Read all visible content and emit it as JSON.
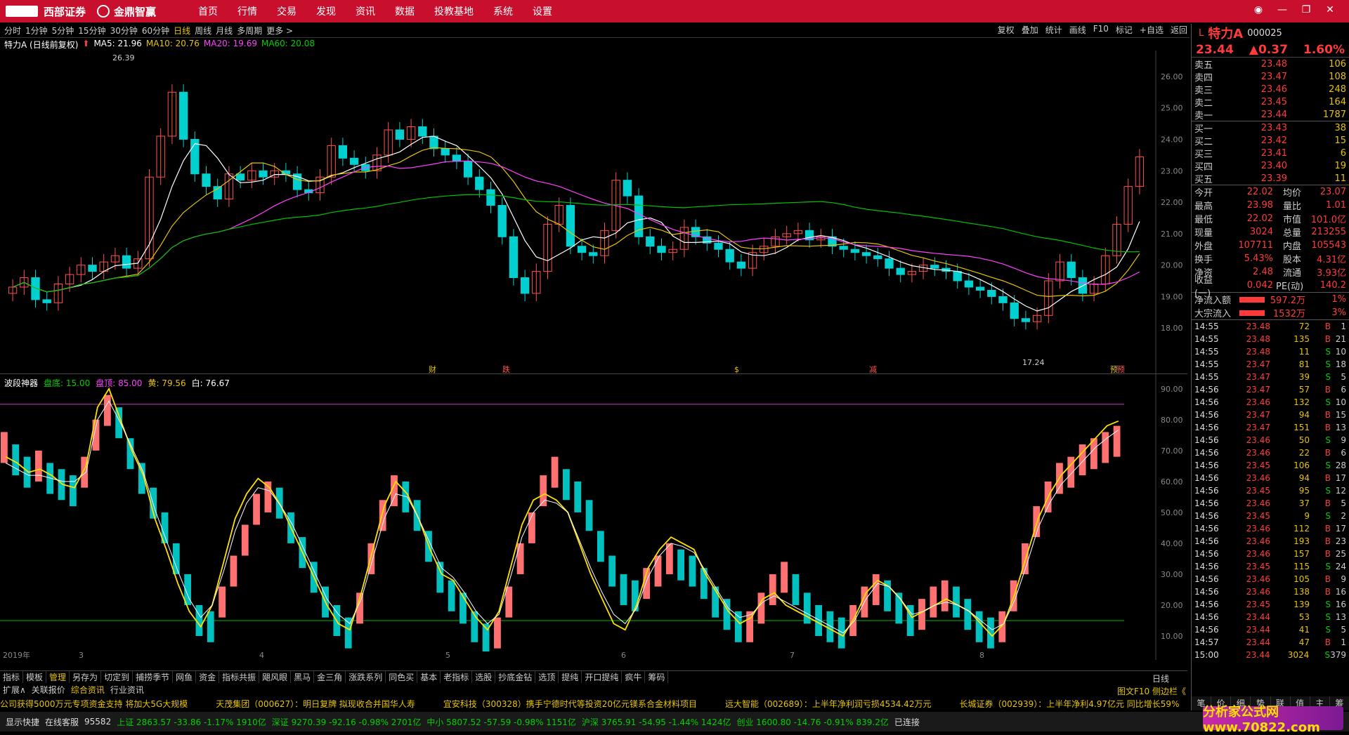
{
  "app": {
    "broker": "西部证券",
    "product": "金鼎智赢"
  },
  "menu": [
    "首页",
    "行情",
    "交易",
    "发现",
    "资讯",
    "数据",
    "投教基地",
    "系统",
    "设置"
  ],
  "periods": [
    "分时",
    "1分钟",
    "5分钟",
    "15分钟",
    "30分钟",
    "60分钟",
    "日线",
    "周线",
    "月线",
    "多周期",
    "更多 >"
  ],
  "active_period": "日线",
  "right_tools": [
    "复权",
    "叠加",
    "统计",
    "画线",
    "F10",
    "标记",
    "+自选",
    "返回"
  ],
  "stock": {
    "name": "特力A",
    "code": "000025",
    "price": "23.44",
    "change": "▲0.37",
    "pct": "1.60%",
    "subtitle": "特力A (日线前复权)"
  },
  "ma": {
    "ma5": "MA5: 21.96",
    "ma10": "MA10: 20.76",
    "ma20": "MA20: 19.69",
    "ma60": "MA60: 20.08"
  },
  "price_axis": [
    "26.00",
    "25.00",
    "24.00",
    "23.00",
    "22.00",
    "21.00",
    "20.00",
    "19.00",
    "18.00"
  ],
  "price_hi": "26.39",
  "price_lo": "17.24",
  "events": [
    "财",
    "跌",
    "$",
    "减",
    "预",
    "预"
  ],
  "indicator": {
    "name": "波段神器",
    "bottom": "盘底: 15.00",
    "top": "盘顶: 85.00",
    "yellow": "黄: 79.56",
    "white": "白: 76.67"
  },
  "ind_axis": [
    "90.00",
    "80.00",
    "70.00",
    "60.00",
    "50.00",
    "40.00",
    "30.00",
    "20.00",
    "10.00"
  ],
  "x_axis": [
    "2019年",
    "3",
    "4",
    "5",
    "6",
    "7",
    "8"
  ],
  "bottom_tabs": [
    "指标",
    "模板",
    "管理",
    "另存为",
    "切定到",
    "捕捞季节",
    "网鱼",
    "资金",
    "指标共振",
    "飓风眼",
    "黑马",
    "金三角",
    "涨跌系列",
    "同色买",
    "基本",
    "老指标",
    "选股",
    "抄底金钻",
    "选顶",
    "提纯",
    "开口提纯",
    "疯牛",
    "筹码"
  ],
  "sub_tabs": [
    "扩展∧",
    "关联报价",
    "综合资讯",
    "行业资讯"
  ],
  "right_label": "日线",
  "f10_label": "图文F10 侧边栏《",
  "ticker": [
    "公司获得5000万元专项资金支持 将加大5G大规模",
    "天茂集团（000627）：明日复牌 拟现收合并国华人寿",
    "宜安科技（300328）携手宁德时代等投资20亿元镁系合金材料项目",
    "远大智能（002689）：上半年净利润亏损4534.42万元",
    "长城证券（002939）：上半年净利4.97亿元 同比增长59%"
  ],
  "status": {
    "show": "显示快捷",
    "service": "在线客服",
    "phone": "95582",
    "sh": "上证 2863.57 -33.86 -1.17% 1910亿",
    "sz": "深证 9270.39 -92.16 -0.98% 2701亿",
    "zx": "中小 5807.52 -57.59 -0.98% 1151亿",
    "hs": "沪深 3765.91 -54.95 -1.44% 1424亿",
    "cy": "创业 1600.80 -14.76 -0.91% 839.2亿",
    "conn": "已连接"
  },
  "asks": [
    [
      "卖五",
      "23.48",
      "106"
    ],
    [
      "卖四",
      "23.47",
      "108"
    ],
    [
      "卖三",
      "23.46",
      "248"
    ],
    [
      "卖二",
      "23.45",
      "164"
    ],
    [
      "卖一",
      "23.44",
      "1787"
    ]
  ],
  "bids": [
    [
      "买一",
      "23.43",
      "38"
    ],
    [
      "买二",
      "23.42",
      "15"
    ],
    [
      "买三",
      "23.41",
      "6"
    ],
    [
      "买四",
      "23.40",
      "19"
    ],
    [
      "买五",
      "23.39",
      "11"
    ]
  ],
  "stats": [
    [
      "今开",
      "22.02",
      "均价",
      "23.07"
    ],
    [
      "最高",
      "23.98",
      "量比",
      "1.01"
    ],
    [
      "最低",
      "22.02",
      "市值",
      "101.0亿"
    ],
    [
      "现量",
      "3024",
      "总量",
      "213255"
    ],
    [
      "外盘",
      "107711",
      "内盘",
      "105543"
    ],
    [
      "换手",
      "5.43%",
      "股本",
      "4.31亿"
    ],
    [
      "净资",
      "2.48",
      "流通",
      "3.93亿"
    ],
    [
      "收益(一)",
      "0.042",
      "PE(动)",
      "140.2"
    ]
  ],
  "flows": [
    [
      "净流入额",
      "597.2万",
      "1%"
    ],
    [
      "大宗流入",
      "1532万",
      "3%"
    ]
  ],
  "trades": [
    [
      "14:55",
      "23.48",
      "72",
      "B",
      "1"
    ],
    [
      "14:55",
      "23.48",
      "135",
      "B",
      "21"
    ],
    [
      "14:55",
      "23.48",
      "11",
      "S",
      "10"
    ],
    [
      "14:55",
      "23.47",
      "81",
      "S",
      "18"
    ],
    [
      "14:55",
      "23.47",
      "39",
      "S",
      "5"
    ],
    [
      "14:56",
      "23.47",
      "57",
      "B",
      "6"
    ],
    [
      "14:56",
      "23.46",
      "132",
      "S",
      "10"
    ],
    [
      "14:56",
      "23.47",
      "94",
      "B",
      "15"
    ],
    [
      "14:56",
      "23.47",
      "151",
      "B",
      "13"
    ],
    [
      "14:56",
      "23.46",
      "50",
      "S",
      "9"
    ],
    [
      "14:56",
      "23.46",
      "22",
      "B",
      "6"
    ],
    [
      "14:56",
      "23.45",
      "106",
      "S",
      "28"
    ],
    [
      "14:56",
      "23.46",
      "94",
      "B",
      "17"
    ],
    [
      "14:56",
      "23.45",
      "95",
      "S",
      "12"
    ],
    [
      "14:56",
      "23.46",
      "37",
      "B",
      "5"
    ],
    [
      "14:56",
      "23.45",
      "9",
      "S",
      "2"
    ],
    [
      "14:56",
      "23.46",
      "112",
      "B",
      "17"
    ],
    [
      "14:56",
      "23.46",
      "193",
      "B",
      "23"
    ],
    [
      "14:56",
      "23.46",
      "157",
      "B",
      "25"
    ],
    [
      "14:56",
      "23.45",
      "115",
      "S",
      "24"
    ],
    [
      "14:56",
      "23.46",
      "105",
      "B",
      "9"
    ],
    [
      "14:56",
      "23.46",
      "138",
      "B",
      "16"
    ],
    [
      "14:56",
      "23.45",
      "139",
      "S",
      "16"
    ],
    [
      "14:56",
      "23.44",
      "53",
      "S",
      "13"
    ],
    [
      "14:56",
      "23.44",
      "41",
      "S",
      "5"
    ],
    [
      "14:57",
      "23.44",
      "47",
      "B",
      "1"
    ],
    [
      "15:00",
      "23.44",
      "3024",
      "S",
      "379"
    ]
  ],
  "right_bottom": [
    "笔",
    "价",
    "细",
    "势",
    "联",
    "值",
    "主",
    "筹"
  ],
  "watermark": "分析家公式网 www.70822.com",
  "chart_data": [
    {
      "type": "candlestick",
      "title": "特力A (日线前复权)",
      "ylim": [
        17.0,
        26.6
      ],
      "close": [
        19.3,
        19.6,
        18.9,
        18.8,
        19.4,
        19.7,
        20.0,
        19.8,
        20.1,
        20.3,
        19.9,
        20.2,
        22.8,
        24.1,
        25.5,
        24.0,
        22.9,
        22.5,
        22.1,
        22.9,
        22.7,
        23.0,
        22.8,
        23.0,
        22.9,
        22.4,
        22.3,
        22.8,
        23.8,
        23.4,
        23.2,
        23.0,
        23.5,
        24.3,
        24.0,
        24.4,
        24.1,
        23.7,
        23.5,
        23.3,
        22.8,
        22.4,
        21.9,
        20.9,
        19.6,
        19.1,
        19.8,
        21.3,
        21.9,
        20.6,
        20.4,
        20.3,
        21.1,
        22.7,
        22.2,
        20.9,
        20.6,
        20.4,
        20.5,
        21.2,
        20.9,
        20.7,
        20.5,
        20.1,
        19.9,
        20.4,
        20.6,
        20.9,
        21.0,
        21.1,
        20.8,
        20.9,
        20.6,
        20.5,
        20.4,
        20.3,
        20.2,
        19.9,
        19.7,
        19.8,
        20.0,
        19.9,
        19.8,
        19.5,
        19.3,
        19.2,
        19.0,
        18.8,
        18.3,
        18.2,
        18.4,
        19.5,
        20.1,
        19.6,
        19.1,
        19.4,
        20.3,
        21.3,
        22.5,
        23.44
      ]
    },
    {
      "type": "line",
      "title": "波段神器",
      "ylim": [
        5,
        92
      ],
      "series": [
        {
          "name": "黄",
          "values": [
            68,
            66,
            63,
            64,
            62,
            59,
            58,
            65,
            84,
            90,
            80,
            70,
            62,
            48,
            38,
            27,
            18,
            13,
            20,
            34,
            48,
            56,
            61,
            58,
            52,
            44,
            36,
            28,
            20,
            14,
            12,
            24,
            38,
            52,
            60,
            56,
            48,
            38,
            30,
            28,
            22,
            16,
            12,
            18,
            32,
            46,
            54,
            56,
            54,
            50,
            40,
            30,
            22,
            14,
            12,
            20,
            32,
            38,
            42,
            40,
            38,
            30,
            24,
            18,
            14,
            16,
            22,
            24,
            20,
            18,
            16,
            14,
            12,
            10,
            16,
            24,
            28,
            26,
            22,
            16,
            18,
            20,
            22,
            20,
            18,
            14,
            10,
            14,
            24,
            36,
            48,
            56,
            62,
            66,
            70,
            74,
            78,
            79.56
          ]
        },
        {
          "name": "白",
          "values": [
            66,
            64,
            62,
            62,
            61,
            60,
            60,
            63,
            80,
            86,
            79,
            71,
            63,
            51,
            41,
            31,
            22,
            16,
            20,
            31,
            44,
            53,
            58,
            57,
            52,
            46,
            38,
            30,
            22,
            17,
            14,
            22,
            35,
            48,
            56,
            55,
            48,
            40,
            32,
            29,
            24,
            18,
            14,
            17,
            29,
            42,
            50,
            54,
            53,
            50,
            41,
            32,
            24,
            17,
            14,
            19,
            29,
            36,
            40,
            39,
            37,
            31,
            25,
            19,
            16,
            17,
            21,
            23,
            21,
            19,
            17,
            15,
            13,
            11,
            15,
            22,
            27,
            26,
            22,
            17,
            18,
            20,
            21,
            20,
            18,
            15,
            12,
            14,
            22,
            33,
            45,
            53,
            59,
            63,
            67,
            71,
            74,
            76.67
          ]
        }
      ],
      "bars": [
        76,
        72,
        68,
        70,
        66,
        64,
        62,
        68,
        80,
        88,
        84,
        74,
        66,
        58,
        50,
        40,
        30,
        20,
        18,
        26,
        36,
        46,
        56,
        60,
        58,
        50,
        42,
        34,
        26,
        20,
        16,
        24,
        40,
        54,
        62,
        60,
        54,
        44,
        34,
        28,
        24,
        18,
        14,
        16,
        26,
        40,
        50,
        62,
        68,
        64,
        60,
        54,
        44,
        36,
        30,
        28,
        32,
        36,
        40,
        38,
        36,
        32,
        26,
        22,
        18,
        18,
        24,
        30,
        34,
        30,
        24,
        20,
        18,
        16,
        20,
        26,
        30,
        28,
        24,
        20,
        22,
        26,
        28,
        26,
        22,
        18,
        16,
        18,
        28,
        40,
        52,
        60,
        66,
        68,
        72,
        74,
        76,
        78
      ]
    }
  ]
}
